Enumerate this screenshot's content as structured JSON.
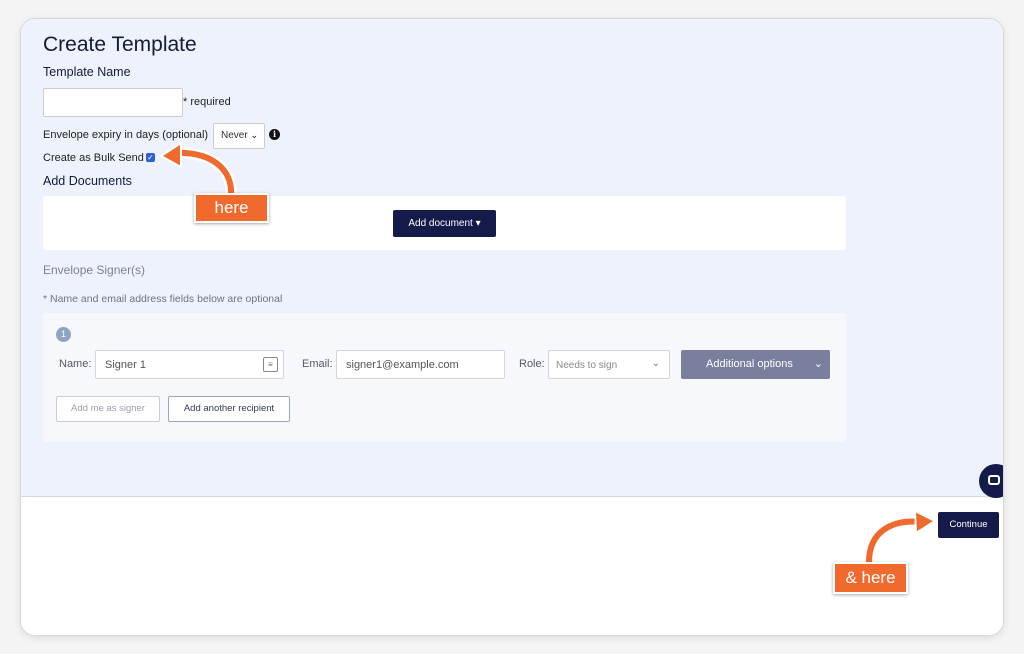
{
  "page": {
    "title": "Create Template",
    "template_name_label": "Template Name",
    "template_name_value": "",
    "required_note": "* required",
    "expiry_label": "Envelope expiry in days (optional)",
    "expiry_value": "Never",
    "bulk_send_label": "Create as Bulk Send",
    "bulk_send_checked": true,
    "add_documents_label": "Add Documents",
    "add_document_button": "Add document",
    "signers_title": "Envelope Signer(s)",
    "signers_note": "* Name and email address fields below are optional"
  },
  "signer": {
    "number": "1",
    "name_label": "Name:",
    "name_value": "Signer 1",
    "email_label": "Email:",
    "email_value": "signer1@example.com",
    "role_label": "Role:",
    "role_value": "Needs to sign",
    "additional_options_button": "Additional options",
    "add_me_button": "Add me as signer",
    "add_another_button": "Add another recipient"
  },
  "footer": {
    "continue_button": "Continue"
  },
  "annotations": {
    "callout_1": "here",
    "callout_2": "& here",
    "accent_color": "#ef6a2c"
  },
  "icons": [
    "info-icon",
    "checkbox-checked-icon",
    "caret-down-icon",
    "chevron-down-icon",
    "contact-card-icon",
    "chat-icon"
  ]
}
